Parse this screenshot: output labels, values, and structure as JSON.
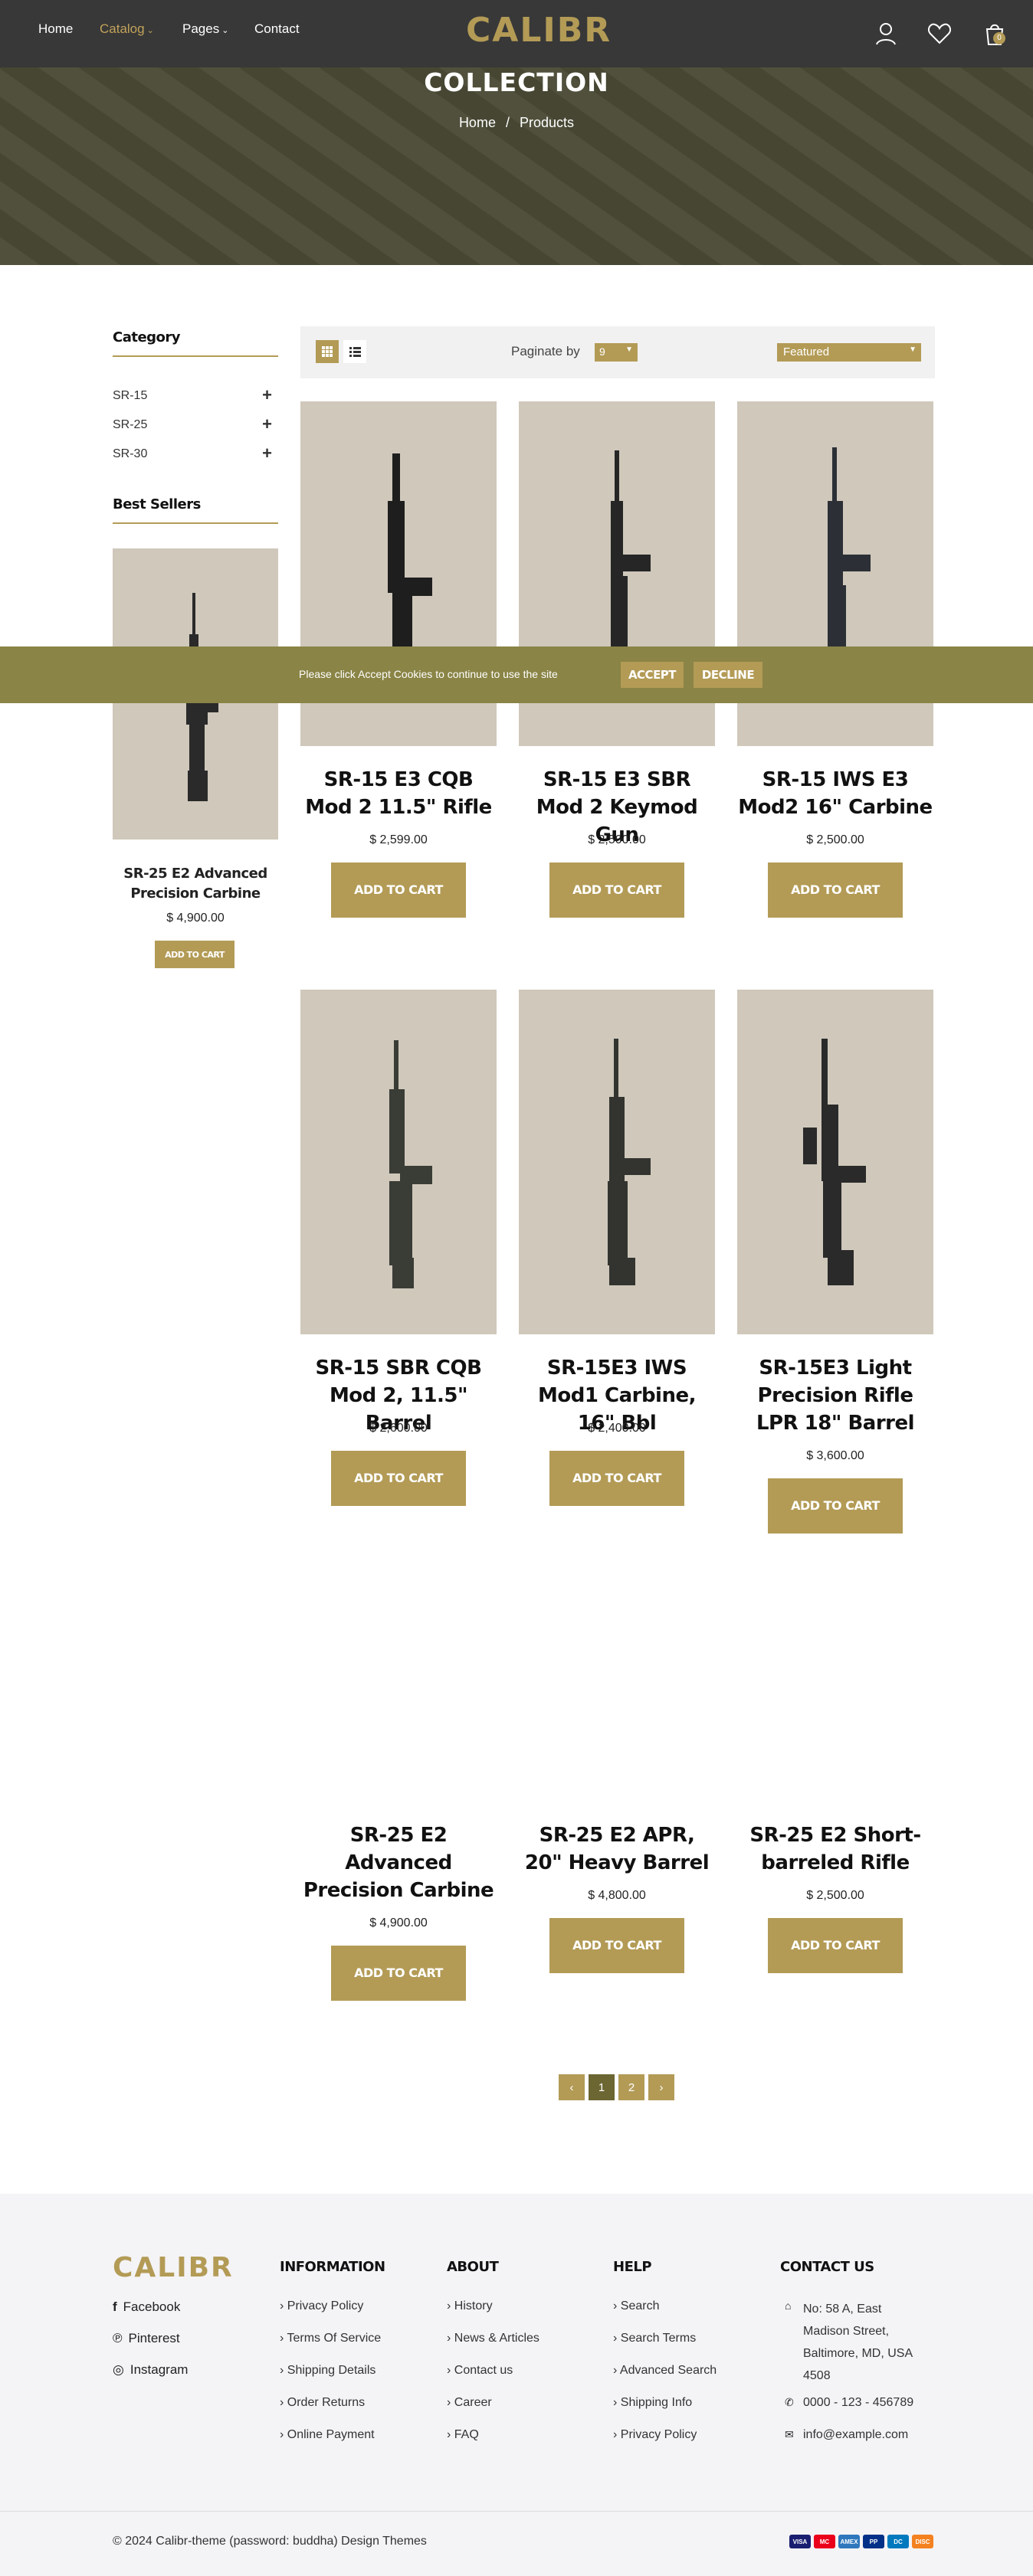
{
  "nav": {
    "home": "Home",
    "catalog": "Catalog",
    "pages": "Pages",
    "contact": "Contact",
    "logo": "CALIBR",
    "cart_count": "0"
  },
  "banner": {
    "title": "COLLECTION",
    "crumb_home": "Home",
    "crumb_sep": "/",
    "crumb_current": "Products"
  },
  "sidebar": {
    "category_title": "Category",
    "categories": [
      {
        "label": "SR-15"
      },
      {
        "label": "SR-25"
      },
      {
        "label": "SR-30"
      }
    ],
    "best_sellers_title": "Best Sellers",
    "best_seller": {
      "name": "SR-25 E2 Advanced Precision Carbine",
      "price": "$ 4,900.00",
      "button": "ADD TO CART"
    }
  },
  "toolbar": {
    "paginate_label": "Paginate by",
    "paginate_value": "9",
    "sort_value": "Featured"
  },
  "products": [
    {
      "name": "SR-15 E3 CQB Mod 2 11.5\" Rifle",
      "price": "$ 2,599.00",
      "button": "ADD TO CART"
    },
    {
      "name": "SR-15 E3 SBR Mod 2 Keymod Gun",
      "price": "$ 2,500.00",
      "button": "ADD TO CART"
    },
    {
      "name": "SR-15 IWS E3 Mod2 16\" Carbine",
      "price": "$ 2,500.00",
      "button": "ADD TO CART"
    },
    {
      "name": "SR-15 SBR CQB Mod 2, 11.5\" Barrel",
      "price": "$ 2,600.00",
      "button": "ADD TO CART"
    },
    {
      "name": "SR-15E3 IWS Mod1 Carbine, 16\" Bbl",
      "price": "$ 2,400.00",
      "button": "ADD TO CART"
    },
    {
      "name": "SR-15E3 Light Precision Rifle LPR 18\" Barrel",
      "price": "$ 3,600.00",
      "button": "ADD TO CART"
    },
    {
      "name": "SR-25 E2 Advanced Precision Carbine",
      "price": "$ 4,900.00",
      "button": "ADD TO CART"
    },
    {
      "name": "SR-25 E2 APR, 20\" Heavy Barrel",
      "price": "$ 4,800.00",
      "button": "ADD TO CART"
    },
    {
      "name": "SR-25 E2 Short-barreled Rifle",
      "price": "$ 2,500.00",
      "button": "ADD TO CART"
    }
  ],
  "cookie": {
    "text": "Please click Accept Cookies to continue to use the site",
    "accept": "ACCEPT",
    "decline": "DECLINE"
  },
  "pagination": {
    "prev": "‹",
    "pages": [
      "1",
      "2"
    ],
    "next": "›"
  },
  "footer": {
    "logo": "CALIBR",
    "social": [
      {
        "label": "Facebook",
        "icon": "facebook-icon"
      },
      {
        "label": "Pinterest",
        "icon": "pinterest-icon"
      },
      {
        "label": "Instagram",
        "icon": "instagram-icon"
      }
    ],
    "information": {
      "title": "INFORMATION",
      "links": [
        "Privacy Policy",
        "Terms Of Service",
        "Shipping Details",
        "Order Returns",
        "Online Payment"
      ]
    },
    "about": {
      "title": "ABOUT",
      "links": [
        "History",
        "News & Articles",
        "Contact us",
        "Career",
        "FAQ"
      ]
    },
    "help": {
      "title": "HELP",
      "links": [
        "Search",
        "Search Terms",
        "Advanced Search",
        "Shipping Info",
        "Privacy Policy"
      ]
    },
    "contact": {
      "title": "CONTACT US",
      "address": "No: 58 A, East Madison Street, Baltimore, MD, USA 4508",
      "phone": "0000 - 123 - 456789",
      "email": "info@example.com"
    },
    "copyright": "© 2024 Calibr-theme (password: buddha) Design Themes",
    "payments": [
      "VISA",
      "MC",
      "AMEX",
      "PP",
      "DC",
      "DISC"
    ]
  },
  "colors": {
    "accent": "#b39b56",
    "header_bg": "#383838",
    "cookie_bg": "#8a8446",
    "product_bg": "#cfc8bb"
  }
}
